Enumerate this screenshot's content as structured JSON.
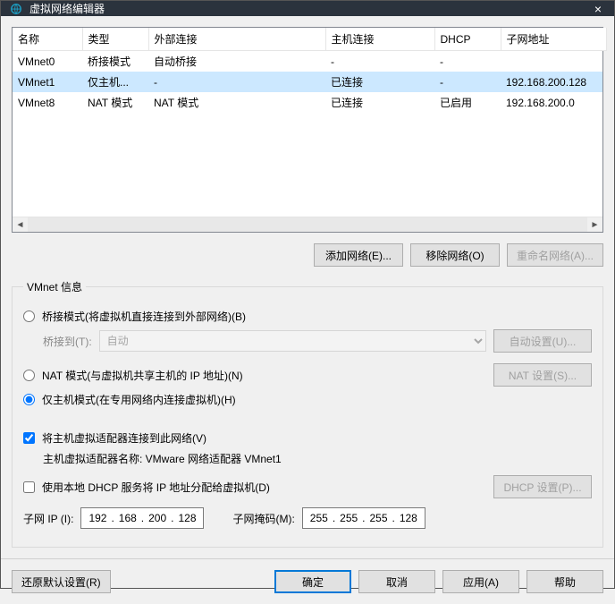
{
  "window": {
    "title": "虚拟网络编辑器",
    "close": "×"
  },
  "table": {
    "headers": [
      "名称",
      "类型",
      "外部连接",
      "主机连接",
      "DHCP",
      "子网地址"
    ],
    "widths": [
      78,
      74,
      198,
      122,
      74,
      118
    ],
    "rows": [
      {
        "c": [
          "VMnet0",
          "桥接模式",
          "自动桥接",
          "-",
          "-",
          ""
        ],
        "sel": false
      },
      {
        "c": [
          "VMnet1",
          "仅主机...",
          "-",
          "已连接",
          "-",
          "192.168.200.128"
        ],
        "sel": true
      },
      {
        "c": [
          "VMnet8",
          "NAT 模式",
          "NAT 模式",
          "已连接",
          "已启用",
          "192.168.200.0"
        ],
        "sel": false
      }
    ]
  },
  "buttons": {
    "add": "添加网络(E)...",
    "remove": "移除网络(O)",
    "rename": "重命名网络(A)..."
  },
  "group": {
    "legend": "VMnet 信息",
    "bridged": "桥接模式(将虚拟机直接连接到外部网络)(B)",
    "bridge_to": "桥接到(T):",
    "bridge_auto": "自动",
    "auto_set": "自动设置(U)...",
    "nat": "NAT 模式(与虚拟机共享主机的 IP 地址)(N)",
    "nat_set": "NAT 设置(S)...",
    "hostonly": "仅主机模式(在专用网络内连接虚拟机)(H)",
    "connect_host": "将主机虚拟适配器连接到此网络(V)",
    "adapter_line": "主机虚拟适配器名称: VMware 网络适配器 VMnet1",
    "use_dhcp": "使用本地 DHCP 服务将 IP 地址分配给虚拟机(D)",
    "dhcp_set": "DHCP 设置(P)...",
    "subnet_ip": "子网 IP (I):",
    "subnet_mask": "子网掩码(M):",
    "ip": [
      "192",
      "168",
      "200",
      "128"
    ],
    "mask": [
      "255",
      "255",
      "255",
      "128"
    ]
  },
  "footer": {
    "restore": "还原默认设置(R)",
    "ok": "确定",
    "cancel": "取消",
    "apply": "应用(A)",
    "help": "帮助"
  }
}
